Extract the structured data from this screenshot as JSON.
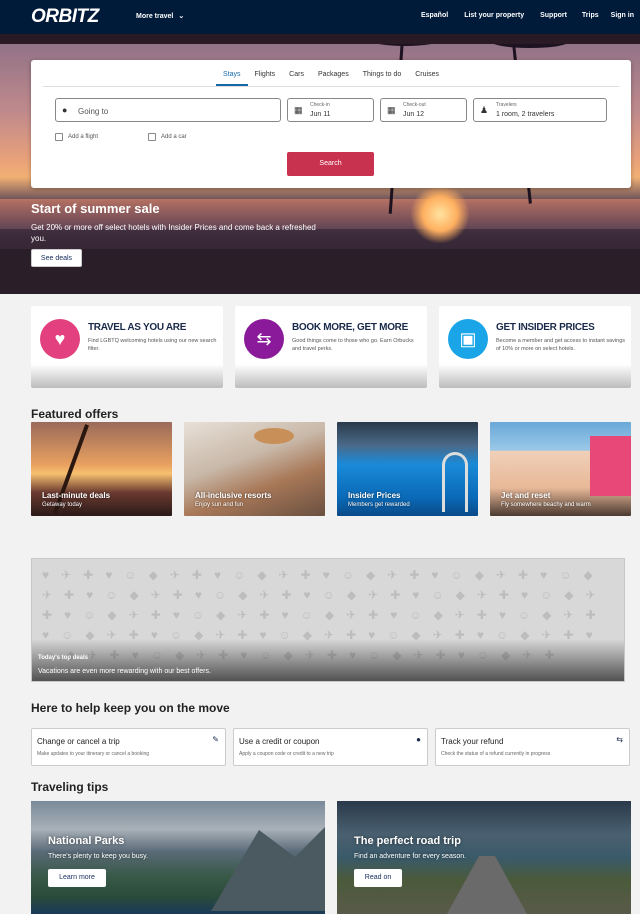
{
  "header": {
    "logo": "ORBITZ",
    "more_travel": "More travel",
    "nav": [
      "Español",
      "List your property",
      "Support",
      "Trips",
      "Sign in"
    ]
  },
  "search": {
    "tabs": [
      "Stays",
      "Flights",
      "Cars",
      "Packages",
      "Things to do",
      "Cruises"
    ],
    "active_tab": "Stays",
    "going_to_placeholder": "Going to",
    "checkin_label": "Check-in",
    "checkin_value": "Jun 11",
    "checkout_label": "Check-out",
    "checkout_value": "Jun 12",
    "travelers_label": "Travelers",
    "travelers_value": "1 room, 2 travelers",
    "add_flight": "Add a flight",
    "add_car": "Add a car",
    "search_button": "Search"
  },
  "promo": {
    "title": "Start of summer sale",
    "text": "Get 20% or more off select hotels with Insider Prices and come back a refreshed you.",
    "button": "See deals"
  },
  "features": [
    {
      "title": "TRAVEL AS YOU ARE",
      "text": "Find LGBTQ welcoming hotels using our new search filter.",
      "color": "#e2407f",
      "icon": "suitcase-heart-icon"
    },
    {
      "title": "BOOK MORE, GET MORE",
      "text": "Good things come to those who go. Earn Orbucks and travel perks.",
      "color": "#8a1a9a",
      "icon": "orbucks-icon"
    },
    {
      "title": "GET INSIDER PRICES",
      "text": "Become a member and get access to instant savings of 10% or more on select hotels.",
      "color": "#1aa5e8",
      "icon": "unlock-icon"
    }
  ],
  "featured_offers": {
    "heading": "Featured offers",
    "items": [
      {
        "title": "Last-minute deals",
        "sub": "Getaway today"
      },
      {
        "title": "All-inclusive resorts",
        "sub": "Enjoy sun and fun"
      },
      {
        "title": "Insider Prices",
        "sub": "Members get rewarded"
      },
      {
        "title": "Jet and reset",
        "sub": "Fly somewhere beachy and warm"
      }
    ]
  },
  "top_deals": {
    "title": "Today's top deals",
    "text": "Vacations are even more rewarding with our best offers."
  },
  "help": {
    "heading": "Here to help keep you on the move",
    "cards": [
      {
        "title": "Change or cancel a trip",
        "text": "Make updates to your itinerary or cancel a booking",
        "icon": "pencil-icon"
      },
      {
        "title": "Use a credit or coupon",
        "text": "Apply a coupon code or credit to a new trip",
        "icon": "coupon-icon"
      },
      {
        "title": "Track your refund",
        "text": "Check the status of a refund currently in progress",
        "icon": "refund-icon"
      }
    ]
  },
  "tips": {
    "heading": "Traveling tips",
    "cards": [
      {
        "title": "National Parks",
        "text": "There's plenty to keep you busy.",
        "button": "Learn more"
      },
      {
        "title": "The perfect road trip",
        "text": "Find an adventure for every season.",
        "button": "Read on"
      }
    ]
  }
}
